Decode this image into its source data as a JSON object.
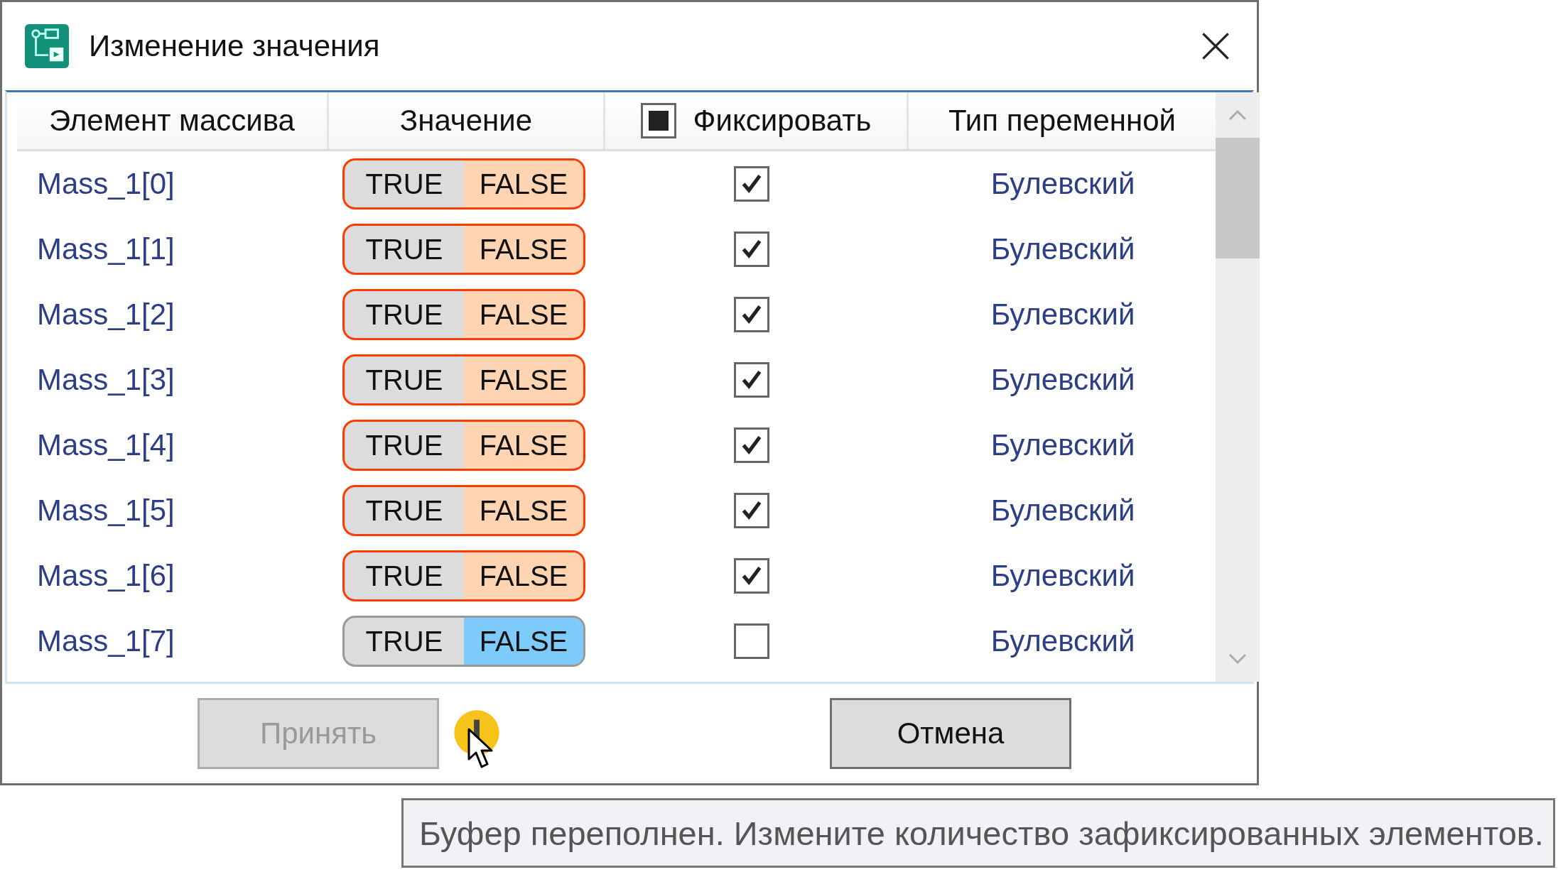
{
  "window": {
    "title": "Изменение значения"
  },
  "table": {
    "columns": [
      {
        "label": "Элемент массива"
      },
      {
        "label": "Значение"
      },
      {
        "label": "Фиксировать",
        "kind": "checkbox",
        "indeterminate": true
      },
      {
        "label": "Тип переменной"
      }
    ],
    "rows": [
      {
        "element": "Mass_1[0]",
        "options": [
          {
            "label": "TRUE",
            "selected": false
          },
          {
            "label": "FALSE",
            "selected": true
          }
        ],
        "fixed": true,
        "type": "Булевский"
      },
      {
        "element": "Mass_1[1]",
        "options": [
          {
            "label": "TRUE",
            "selected": false
          },
          {
            "label": "FALSE",
            "selected": true
          }
        ],
        "fixed": true,
        "type": "Булевский"
      },
      {
        "element": "Mass_1[2]",
        "options": [
          {
            "label": "TRUE",
            "selected": false
          },
          {
            "label": "FALSE",
            "selected": true
          }
        ],
        "fixed": true,
        "type": "Булевский"
      },
      {
        "element": "Mass_1[3]",
        "options": [
          {
            "label": "TRUE",
            "selected": false
          },
          {
            "label": "FALSE",
            "selected": true
          }
        ],
        "fixed": true,
        "type": "Булевский"
      },
      {
        "element": "Mass_1[4]",
        "options": [
          {
            "label": "TRUE",
            "selected": false
          },
          {
            "label": "FALSE",
            "selected": true
          }
        ],
        "fixed": true,
        "type": "Булевский"
      },
      {
        "element": "Mass_1[5]",
        "options": [
          {
            "label": "TRUE",
            "selected": false
          },
          {
            "label": "FALSE",
            "selected": true
          }
        ],
        "fixed": true,
        "type": "Булевский"
      },
      {
        "element": "Mass_1[6]",
        "options": [
          {
            "label": "TRUE",
            "selected": false
          },
          {
            "label": "FALSE",
            "selected": true
          }
        ],
        "fixed": true,
        "type": "Булевский"
      },
      {
        "element": "Mass_1[7]",
        "options": [
          {
            "label": "TRUE",
            "selected": false
          },
          {
            "label": "FALSE",
            "selected": true
          }
        ],
        "fixed": false,
        "type": "Булевский"
      }
    ]
  },
  "buttons": [
    {
      "label": "Принять",
      "disabled": true
    },
    {
      "label": "Отмена",
      "disabled": false
    }
  ],
  "warning": {
    "tooltip": "Буфер переполнен. Измените количество зафиксированных элементов."
  }
}
